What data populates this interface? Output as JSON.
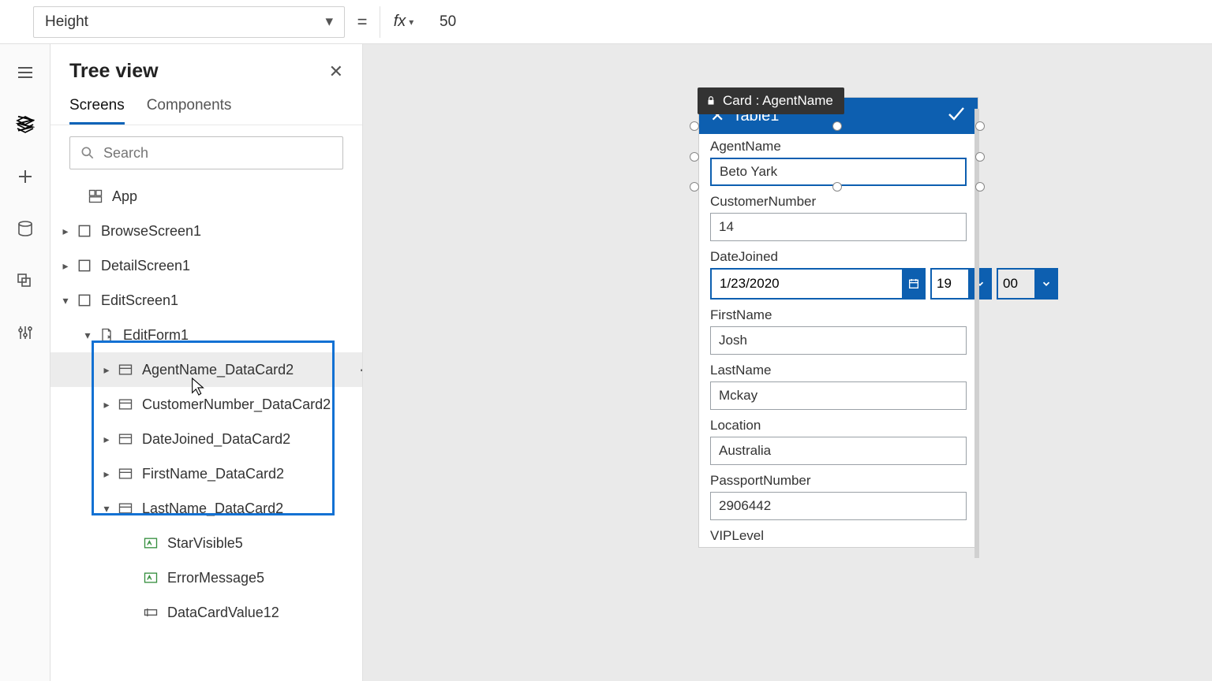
{
  "topbar": {
    "property": "Height",
    "formula": "50"
  },
  "treeView": {
    "title": "Tree view",
    "tabs": {
      "screens": "Screens",
      "components": "Components"
    },
    "searchPlaceholder": "Search",
    "items": {
      "app": "App",
      "browseScreen": "BrowseScreen1",
      "detailScreen": "DetailScreen1",
      "editScreen": "EditScreen1",
      "editForm": "EditForm1",
      "cards": {
        "agent": "AgentName_DataCard2",
        "customer": "CustomerNumber_DataCard2",
        "date": "DateJoined_DataCard2",
        "first": "FirstName_DataCard2",
        "last": "LastName_DataCard2"
      },
      "children": {
        "star": "StarVisible5",
        "error": "ErrorMessage5",
        "value": "DataCardValue12"
      }
    }
  },
  "selectedTooltip": "Card : AgentName",
  "form": {
    "headerTitle": "Table1",
    "fields": {
      "agentName": {
        "label": "AgentName",
        "value": "Beto Yark"
      },
      "customerNumber": {
        "label": "CustomerNumber",
        "value": "14"
      },
      "dateJoined": {
        "label": "DateJoined",
        "date": "1/23/2020",
        "hour": "19",
        "minute": "00"
      },
      "firstName": {
        "label": "FirstName",
        "value": "Josh"
      },
      "lastName": {
        "label": "LastName",
        "value": "Mckay"
      },
      "location": {
        "label": "Location",
        "value": "Australia"
      },
      "passport": {
        "label": "PassportNumber",
        "value": "2906442"
      },
      "vip": {
        "label": "VIPLevel"
      }
    }
  }
}
